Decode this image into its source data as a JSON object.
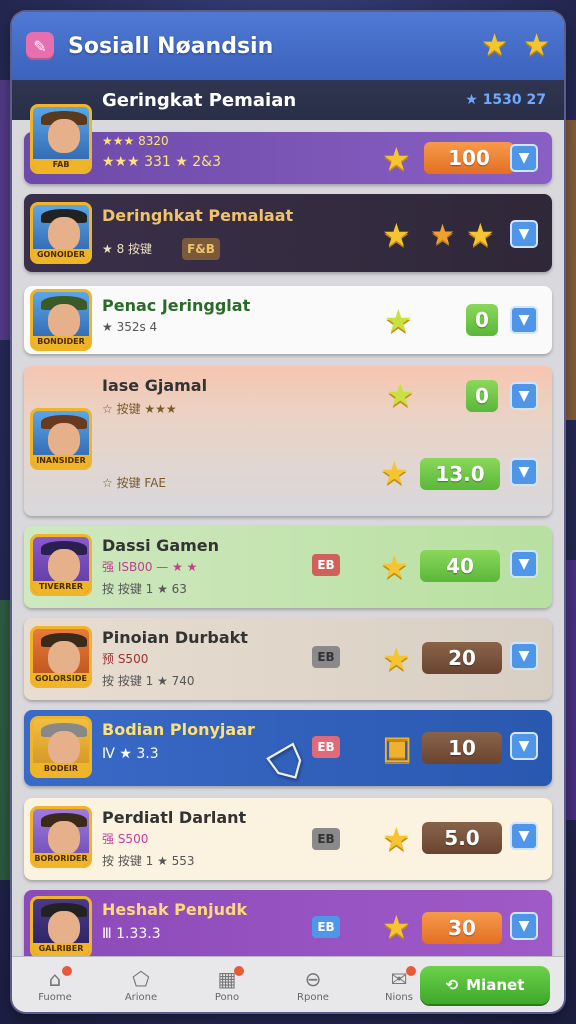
{
  "header": {
    "title": "Sosiall Nøandsin",
    "icon": "pencil-icon"
  },
  "leaderboard_header": {
    "title": "Geringkat Pemaian",
    "points": "1530 27"
  },
  "rows": [
    {
      "name": "Geringkat Pemaian",
      "line1": "★★★ 8320",
      "line2": "★★★ 331  ★ 2&3",
      "score": "100",
      "tag": "FAB"
    },
    {
      "name": "Deringhkat Pemalaat",
      "line1": "★ 8 按键",
      "line2": "",
      "score": "",
      "tag": "GONOIDER",
      "badge": "F&B"
    },
    {
      "name": "Penac Jeringglat",
      "line1": "★ 352s 4",
      "line2": "",
      "score": "0",
      "tag": "BONDIDER"
    },
    {
      "name": "Iase Gjamal",
      "line1": "☆ 按键 ★★★",
      "line2": "☆ 按键 FAE",
      "score_a": "0",
      "score": "13.0",
      "tag": "INANSIDER"
    },
    {
      "name": "Dassi Gamen",
      "line1": "强 ISB00 — ★ ★",
      "line2": "按 按键 1 ★ 63",
      "score": "40",
      "tag": "TIVERRER",
      "badge": "EB"
    },
    {
      "name": "Pinoian Durbakt",
      "line1": "预 S500",
      "line2": "按 按键 1 ★ 740",
      "score": "20",
      "tag": "GOLORSIDE",
      "badge": "EB"
    },
    {
      "name": "Bodian Plonyjaar",
      "line1": "Ⅳ ★ 3.3",
      "line2": "",
      "score": "10",
      "tag": "BODEIR",
      "badge": "EB"
    },
    {
      "name": "Perdiatl Darlant",
      "line1": "强 S500",
      "line2": "按 按键 1 ★ 553",
      "score": "5.0",
      "tag": "BORORIDER",
      "badge": "EB"
    },
    {
      "name": "Heshak Penjudk",
      "line1": "Ⅲ 1.33.3",
      "line2": "",
      "score": "30",
      "tag": "GALRIBER",
      "badge": "EB"
    }
  ],
  "nav": [
    {
      "label": "Fuome",
      "icon": "home-icon",
      "dot": true
    },
    {
      "label": "Arione",
      "icon": "pentagon-icon",
      "dot": false
    },
    {
      "label": "Pono",
      "icon": "gift-icon",
      "dot": true
    },
    {
      "label": "Rpone",
      "icon": "lock-icon",
      "dot": false
    },
    {
      "label": "Nions",
      "icon": "chat-icon",
      "dot": true
    }
  ],
  "cta": {
    "label": "Mianet",
    "icon": "link-icon"
  },
  "colors": {
    "header": "#4f79d4",
    "accent_orange": "#f08a3c",
    "accent_green": "#7acc4e",
    "accent_brown": "#7a5236"
  }
}
